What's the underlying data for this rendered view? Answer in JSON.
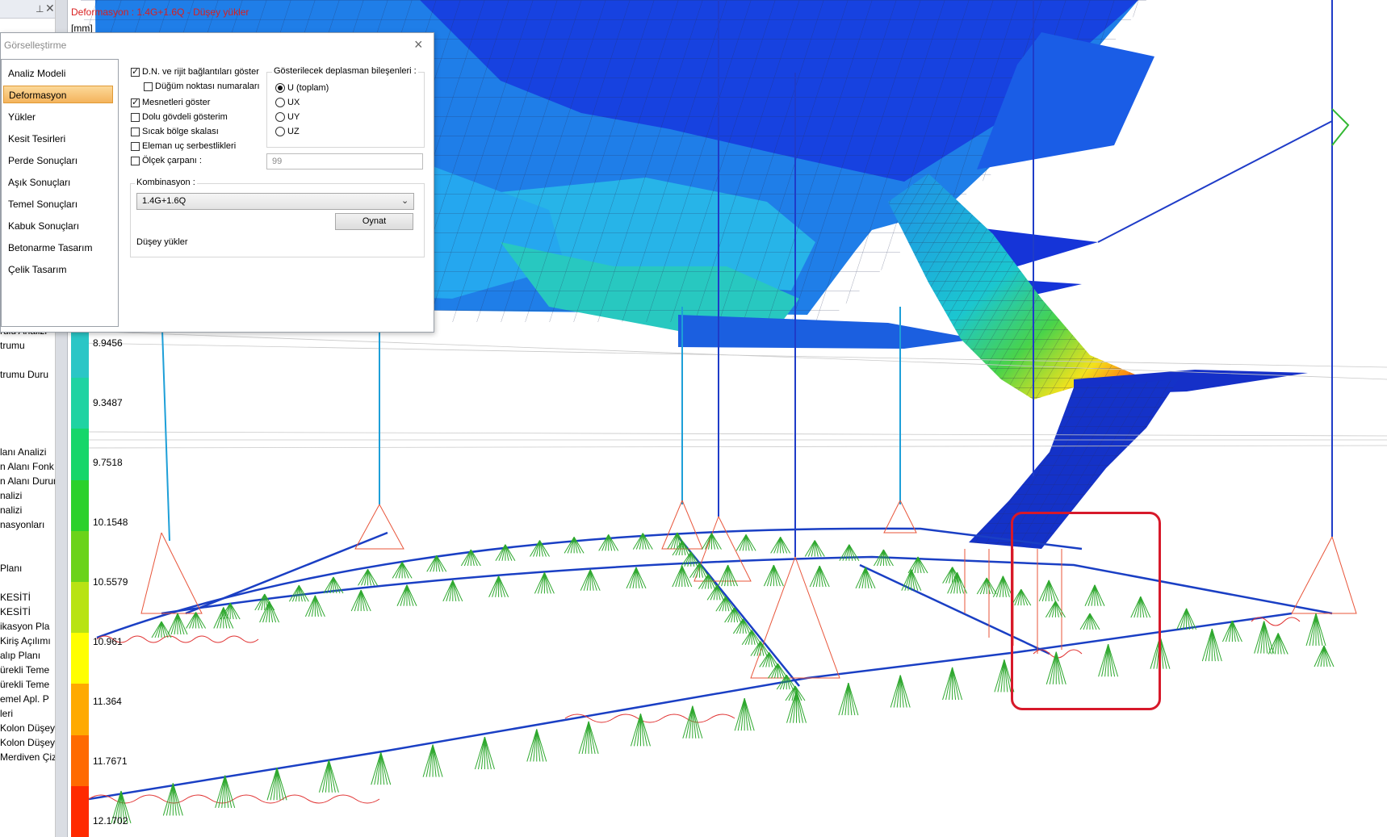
{
  "viewport": {
    "title": "Deformasyon : 1.4G+1.6Q  -  Düşey yükler",
    "unit": "[mm]"
  },
  "legend": {
    "labels": [
      "8.9456",
      "9.3487",
      "9.7518",
      "10.1548",
      "10.5579",
      "10.961",
      "11.364",
      "11.7671",
      "12.1702"
    ],
    "colors": [
      "#2bc6c6",
      "#1fd3a2",
      "#16d66a",
      "#2bd12c",
      "#6bd31a",
      "#b8e314",
      "#ffff00",
      "#ffaa00",
      "#ff6a00",
      "#ff2a00"
    ]
  },
  "left_tree": {
    "items": [
      "rulu Analizi",
      "trumu",
      "trumu Duru",
      "lanı Analizi",
      "n Alanı Fonk",
      "n Alanı Durumu",
      "nalizi",
      "nalizi",
      "nasyonları",
      "Planı",
      "KESİTİ",
      "KESİTİ",
      "ikasyon Pla",
      "Kiriş Açılımı",
      "alıp Planı",
      "ürekli Teme",
      "ürekli Teme",
      "emel Apl. P",
      "leri",
      "Kolon Düşey",
      "Kolon Düşey",
      "Merdiven Çiz"
    ]
  },
  "dialog": {
    "title": "Görselleştirme",
    "close_symbol": "×",
    "nav": [
      "Analiz Modeli",
      "Deformasyon",
      "Yükler",
      "Kesit Tesirleri",
      "Perde Sonuçları",
      "Aşık Sonuçları",
      "Temel Sonuçları",
      "Kabuk Sonuçları",
      "Betonarme Tasarım",
      "Çelik Tasarım"
    ],
    "selected_nav": "Deformasyon",
    "options": {
      "show_links": "D.N. ve rijit bağlantıları göster",
      "node_numbers": "Düğüm noktası numaraları",
      "show_supports": "Mesnetleri göster",
      "solid_display": "Dolu gövdeli gösterim",
      "heat_scale": "Sıcak bölge skalası",
      "end_releases": "Eleman uç serbestlikleri",
      "scale_factor": "Ölçek çarpanı :"
    },
    "scale_value": "99",
    "displacement_group": {
      "title": "Gösterilecek deplasman bileşenleri :",
      "options": [
        "U (toplam)",
        "UX",
        "UY",
        "UZ"
      ],
      "selected": "U (toplam)"
    },
    "combination": {
      "title": "Kombinasyon :",
      "selected": "1.4G+1.6Q",
      "play": "Oynat",
      "description": "Düşey yükler"
    }
  }
}
